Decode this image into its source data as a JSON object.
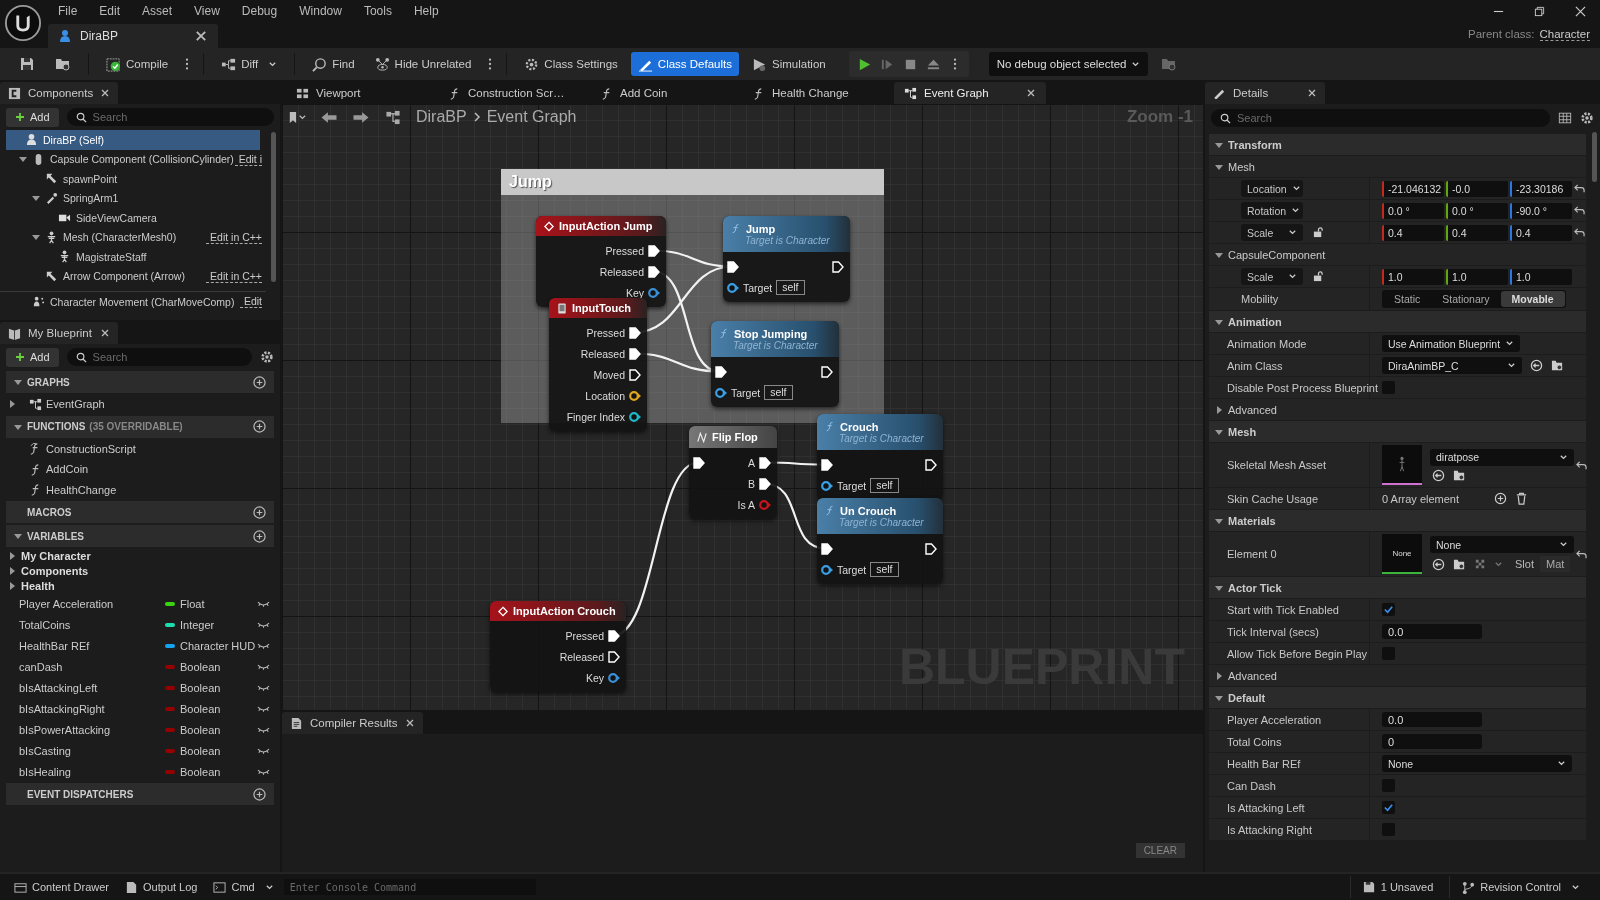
{
  "window": {
    "menu": [
      "File",
      "Edit",
      "Asset",
      "View",
      "Debug",
      "Window",
      "Tools",
      "Help"
    ],
    "document_tab": "DiraBP",
    "parent_class_label": "Parent class:",
    "parent_class": "Character"
  },
  "toolbar": {
    "buttons": [
      {
        "label": "Compile",
        "selected": false
      },
      {
        "label": "Diff",
        "selected": false
      },
      {
        "label": "Find",
        "selected": false
      },
      {
        "label": "Hide Unrelated",
        "selected": false
      },
      {
        "label": "Class Settings",
        "selected": false
      },
      {
        "label": "Class Defaults",
        "selected": true
      },
      {
        "label": "Simulation",
        "selected": false
      }
    ],
    "debug_object": "No debug object selected"
  },
  "components": {
    "title": "Components",
    "add": "Add",
    "search_placeholder": "Search",
    "tree": [
      {
        "label": "DiraBP (Self)",
        "kind": "self",
        "selected": true,
        "children": [
          {
            "label": "Capsule Component (CollisionCylinder)",
            "kind": "capsule",
            "selected": false,
            "expanded": true,
            "edit": "Edit i",
            "children": [
              {
                "label": "spawnPoint",
                "kind": "arrow",
                "selected": false
              },
              {
                "label": "SpringArm1",
                "kind": "spring",
                "selected": false,
                "expanded": true,
                "children": [
                  {
                    "label": "SideViewCamera",
                    "kind": "camera",
                    "selected": false
                  }
                ]
              },
              {
                "label": "Mesh (CharacterMesh0)",
                "kind": "mesh",
                "selected": false,
                "expanded": true,
                "edit": "Edit in C++",
                "children": [
                  {
                    "label": "MagistrateStaff",
                    "kind": "mesh",
                    "selected": false
                  }
                ]
              },
              {
                "label": "Arrow Component (Arrow)",
                "kind": "arrow",
                "selected": false,
                "edit": "Edit in C++"
              }
            ]
          },
          {
            "label": "Character Movement (CharMoveComp)",
            "kind": "movement",
            "selected": false,
            "edit": "Edit"
          }
        ]
      }
    ]
  },
  "my_blueprint": {
    "title": "My Blueprint",
    "add": "Add",
    "search_placeholder": "Search",
    "sections": [
      {
        "title": "GRAPHS",
        "expanded": true,
        "items": [
          {
            "label": "EventGraph",
            "kind": "graph",
            "expanded": false
          }
        ]
      },
      {
        "title": "FUNCTIONS",
        "note": "(35 OVERRIDABLE)",
        "expanded": true,
        "items": [
          {
            "label": "ConstructionScript",
            "kind": "construction"
          },
          {
            "label": "AddCoin",
            "kind": "function"
          },
          {
            "label": "HealthChange",
            "kind": "function"
          }
        ]
      },
      {
        "title": "MACROS"
      },
      {
        "title": "VARIABLES",
        "expanded": true,
        "categories": [
          {
            "label": "My Character",
            "expanded": false
          },
          {
            "label": "Components",
            "expanded": false
          },
          {
            "label": "Health",
            "expanded": false
          }
        ],
        "variables": [
          {
            "name": "Player Acceleration",
            "type": "Float",
            "color": "#39d40f"
          },
          {
            "name": "TotalCoins",
            "type": "Integer",
            "color": "#1fdcae"
          },
          {
            "name": "HealthBar REf",
            "type": "Character HUD",
            "color": "#14a4f0"
          },
          {
            "name": "canDash",
            "type": "Boolean",
            "color": "#950000"
          },
          {
            "name": "bIsAttackingLeft",
            "type": "Boolean",
            "color": "#950000"
          },
          {
            "name": "bIsAttackingRight",
            "type": "Boolean",
            "color": "#950000"
          },
          {
            "name": "bIsPowerAttacking",
            "type": "Boolean",
            "color": "#950000"
          },
          {
            "name": "bIsCasting",
            "type": "Boolean",
            "color": "#950000"
          },
          {
            "name": "bIsHealing",
            "type": "Boolean",
            "color": "#950000"
          }
        ]
      },
      {
        "title": "EVENT DISPATCHERS"
      }
    ]
  },
  "editor_tabs": [
    {
      "label": "Viewport",
      "selected": false
    },
    {
      "label": "Construction Scr…",
      "selected": false
    },
    {
      "label": "Add Coin",
      "selected": false
    },
    {
      "label": "Health Change",
      "selected": false
    },
    {
      "label": "Event Graph",
      "selected": true
    }
  ],
  "graph": {
    "breadcrumb": [
      "DiraBP",
      "Event Graph"
    ],
    "zoom": "Zoom -1",
    "watermark": "BLUEPRINT",
    "comment": "Jump",
    "nodes": [
      {
        "kind": "event",
        "title": "InputAction Jump",
        "outputs": [
          {
            "kind": "exec",
            "label": "Pressed",
            "connected": true
          },
          {
            "kind": "exec",
            "label": "Released",
            "connected": true
          },
          {
            "kind": "data",
            "label": "Key",
            "connected": false,
            "color": "#3b8fd6"
          }
        ]
      },
      {
        "kind": "event",
        "title": "InputTouch",
        "outputs": [
          {
            "kind": "exec",
            "label": "Pressed",
            "connected": true
          },
          {
            "kind": "exec",
            "label": "Released",
            "connected": true
          },
          {
            "kind": "exec",
            "label": "Moved",
            "connected": false
          },
          {
            "kind": "data",
            "label": "Location",
            "connected": false,
            "color": "#e0a51c"
          },
          {
            "kind": "data",
            "label": "Finger Index",
            "connected": false,
            "color": "#1fb8c8"
          }
        ]
      },
      {
        "kind": "function",
        "title": "Jump",
        "subtitle": "Target is Character",
        "inputs": [
          {
            "kind": "exec",
            "connected": true
          },
          {
            "kind": "data",
            "label": "Target",
            "value": "self",
            "connected": false,
            "color": "#3b9fe6"
          }
        ],
        "outputs": [
          {
            "kind": "exec",
            "connected": false
          }
        ]
      },
      {
        "kind": "function",
        "title": "Stop Jumping",
        "subtitle": "Target is Character",
        "inputs": [
          {
            "kind": "exec",
            "connected": true
          },
          {
            "kind": "data",
            "label": "Target",
            "value": "self",
            "connected": false,
            "color": "#3b9fe6"
          }
        ],
        "outputs": [
          {
            "kind": "exec",
            "connected": false
          }
        ]
      },
      {
        "kind": "macro",
        "title": "Flip Flop",
        "inputs": [
          {
            "kind": "exec",
            "connected": true
          }
        ],
        "outputs": [
          {
            "kind": "exec",
            "label": "A",
            "connected": true
          },
          {
            "kind": "exec",
            "label": "B",
            "connected": true
          },
          {
            "kind": "data",
            "label": "Is A",
            "connected": false,
            "color": "#c8141e"
          }
        ]
      },
      {
        "kind": "function",
        "title": "Crouch",
        "subtitle": "Target is Character",
        "inputs": [
          {
            "kind": "exec",
            "connected": true
          },
          {
            "kind": "data",
            "label": "Target",
            "value": "self",
            "connected": false,
            "color": "#3b9fe6"
          }
        ],
        "outputs": [
          {
            "kind": "exec",
            "connected": false
          }
        ]
      },
      {
        "kind": "function",
        "title": "Un Crouch",
        "subtitle": "Target is Character",
        "inputs": [
          {
            "kind": "exec",
            "connected": true
          },
          {
            "kind": "data",
            "label": "Target",
            "value": "self",
            "connected": false,
            "color": "#3b9fe6"
          }
        ],
        "outputs": [
          {
            "kind": "exec",
            "connected": false
          }
        ]
      },
      {
        "kind": "event",
        "title": "InputAction Crouch",
        "outputs": [
          {
            "kind": "exec",
            "label": "Pressed",
            "connected": true
          },
          {
            "kind": "exec",
            "label": "Released",
            "connected": false
          },
          {
            "kind": "data",
            "label": "Key",
            "connected": false,
            "color": "#3b8fd6"
          }
        ]
      }
    ]
  },
  "compiler": {
    "title": "Compiler Results",
    "clear": "CLEAR"
  },
  "details": {
    "title": "Details",
    "search_placeholder": "Search",
    "rows": [
      {
        "kind": "section",
        "label": "Transform",
        "expanded": true
      },
      {
        "kind": "subsection",
        "label": "Mesh",
        "expanded": true
      },
      {
        "kind": "vector",
        "label": "Location",
        "values": [
          "-21.046132",
          "-0.0",
          "-23.30186"
        ],
        "ratio_lock": false,
        "reset": true
      },
      {
        "kind": "vector",
        "label": "Rotation",
        "values": [
          "0.0 °",
          "0.0 °",
          "-90.0 °"
        ],
        "ratio_lock": false,
        "reset": true
      },
      {
        "kind": "vector",
        "label": "Scale",
        "values": [
          "0.4",
          "0.4",
          "0.4"
        ],
        "ratio_lock": true,
        "reset": true
      },
      {
        "kind": "subsection",
        "label": "CapsuleComponent",
        "expanded": true
      },
      {
        "kind": "vector",
        "label": "Scale",
        "values": [
          "1.0",
          "1.0",
          "1.0"
        ],
        "ratio_lock": true,
        "reset": false
      },
      {
        "kind": "segmented",
        "label": "Mobility",
        "options": [
          {
            "label": "Static",
            "selected": false
          },
          {
            "label": "Stationary",
            "selected": false
          },
          {
            "label": "Movable",
            "selected": true
          }
        ]
      },
      {
        "kind": "section",
        "label": "Animation",
        "expanded": true
      },
      {
        "kind": "enum",
        "label": "Animation Mode",
        "value": "Use Animation Blueprint"
      },
      {
        "kind": "class",
        "label": "Anim Class",
        "value": "DiraAnimBP_C"
      },
      {
        "kind": "checkbox",
        "label": "Disable Post Process Blueprint",
        "checked": false
      },
      {
        "kind": "advanced",
        "label": "Advanced",
        "expanded": false
      },
      {
        "kind": "section",
        "label": "Mesh",
        "expanded": true
      },
      {
        "kind": "asset",
        "label": "Skeletal Mesh Asset",
        "value": "diratpose",
        "reset": true
      },
      {
        "kind": "array",
        "label": "Skin Cache Usage",
        "value": "0 Array element"
      },
      {
        "kind": "section",
        "label": "Materials",
        "expanded": true
      },
      {
        "kind": "material",
        "label": "Element 0",
        "thumb": "None",
        "value": "None",
        "slot_label": "Slot",
        "slot": "Mat",
        "reset": true
      },
      {
        "kind": "section",
        "label": "Actor Tick",
        "expanded": true
      },
      {
        "kind": "checkbox",
        "label": "Start with Tick Enabled",
        "checked": true
      },
      {
        "kind": "number",
        "label": "Tick Interval (secs)",
        "value": "0.0"
      },
      {
        "kind": "checkbox",
        "label": "Allow Tick Before Begin Play",
        "checked": false
      },
      {
        "kind": "advanced",
        "label": "Advanced",
        "expanded": false
      },
      {
        "kind": "section",
        "label": "Default",
        "expanded": true
      },
      {
        "kind": "number",
        "label": "Player Acceleration",
        "value": "0.0"
      },
      {
        "kind": "number",
        "label": "Total Coins",
        "value": "0"
      },
      {
        "kind": "object",
        "label": "Health Bar REf",
        "value": "None"
      },
      {
        "kind": "checkbox",
        "label": "Can Dash",
        "checked": false
      },
      {
        "kind": "checkbox",
        "label": "Is Attacking Left",
        "checked": true
      },
      {
        "kind": "checkbox",
        "label": "Is Attacking Right",
        "checked": false
      }
    ]
  },
  "status_bar": {
    "content_drawer": "Content Drawer",
    "output_log": "Output Log",
    "cmd": "Cmd",
    "console_placeholder": "Enter Console Command",
    "unsaved": "1 Unsaved",
    "revision_control": "Revision Control"
  }
}
